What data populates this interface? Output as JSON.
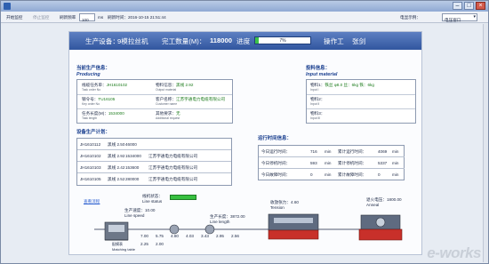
{
  "window": {
    "title": ""
  },
  "toolbar": {
    "start_monitor": "开始监控",
    "stop_monitor": "停止监控",
    "refresh_rate_label": "刷新频率",
    "refresh_rate_value": "100",
    "refresh_unit": "ms",
    "refresh_time": "刷新时间：2016-10-15 21:51:44",
    "screen_label": "电显示例：",
    "screen_select": "电压窗口"
  },
  "banner": {
    "equipment_label": "生产设备：",
    "equipment_value": "9模拉丝机",
    "done_label": "完工数量(M)：",
    "done_value": "118000",
    "progress_label": "进度",
    "progress_pct": "7%",
    "progress_fraction": 0.07,
    "operator_label": "操作工",
    "operator_value": "张剑"
  },
  "producing": {
    "title_cn": "当前生产信息：",
    "title_en": "Producing",
    "task_order_cn": "线缆任务单：",
    "task_order_en": "Task order No",
    "task_order_value": "JH1610102",
    "output_cn": "物料信息：",
    "output_en": "Output material",
    "output_value": "黑线 2.92",
    "key_order_cn": "钢令号：",
    "key_order_en": "Key order No",
    "key_order_value": "TU16105",
    "customer_cn": "客户名称：",
    "customer_en": "Customer name",
    "customer_value": "江苏宇通电力电缆有限公司",
    "task_length_cn": "任务长度(M)：",
    "task_length_en": "Task length",
    "task_length_value": "1534000",
    "additional_cn": "其他要求：",
    "additional_en": "Additional request",
    "additional_value": "无"
  },
  "input_material": {
    "title_cn": "投料信息：",
    "title_en": "Input material",
    "item1_label": "物料1：",
    "item1_value": "铁丝 φ8.0 丝：6kg 铁：6kg",
    "item1_en": "Input I",
    "item2_label": "物料2：",
    "item2_en": "Input II",
    "item3_label": "物料3：",
    "item3_en": "Input III"
  },
  "plan": {
    "title": "设备生产计划：",
    "rows": [
      {
        "order": "JH1610112",
        "material": "黑线 2.50",
        "length": "46000",
        "customer": ""
      },
      {
        "order": "JH1610102",
        "material": "黑线 2.92",
        "length": "1534000",
        "customer": "江苏宇通电力电缆有限公司"
      },
      {
        "order": "JH1610103",
        "material": "黑线 2.42",
        "length": "153600",
        "customer": "江苏宇通电力电缆有限公司"
      },
      {
        "order": "JH1610105",
        "material": "黑线 2.52",
        "length": "280000",
        "customer": "江苏宇通电力电缆有限公司"
      }
    ]
  },
  "runtime": {
    "title": "运行时间信息：",
    "rows": [
      {
        "left_label": "今日运行时间：",
        "left_value": "716",
        "left_unit": "min",
        "right_label": "累计运行时间：",
        "right_value": "4069",
        "right_unit": "min"
      },
      {
        "left_label": "今日停机时间：",
        "left_value": "593",
        "left_unit": "min",
        "right_label": "累计停机时间：",
        "right_value": "5337",
        "right_unit": "min"
      },
      {
        "left_label": "今日故障时间：",
        "left_value": "0",
        "left_unit": "min",
        "right_label": "累计故障时间：",
        "right_value": "0",
        "right_unit": "min"
      }
    ]
  },
  "diagram": {
    "link": "查看流程",
    "line_status_cn": "线机状态：",
    "line_status_en": "Line status",
    "line_speed_cn": "生产速度：",
    "line_speed_value": "10.00",
    "line_speed_en": "Line speed",
    "line_length_cn": "生产长度：",
    "line_length_value": "3872.00",
    "line_length_en": "Line length",
    "tension_cn": "收放张力：",
    "tension_value": "4.60",
    "tension_en": "Tension",
    "anneal_cn": "退火电压：",
    "anneal_value": "1800.00",
    "anneal_en": "Anneal",
    "matching_cn": "配模表",
    "matching_en": "Matching table",
    "dies_row1": [
      "7.00",
      "5.75",
      "4.80",
      "4.03",
      "3.43",
      "2.95",
      "2.56"
    ],
    "dies_row2": [
      "2.25",
      "2.00"
    ]
  },
  "watermark": "e-works",
  "colors": {
    "banner": "#31569f",
    "accent_blue": "#1a3f8f",
    "status_green": "#37c040",
    "value_green": "#1a7a1a",
    "machine_red": "#c8302a"
  }
}
